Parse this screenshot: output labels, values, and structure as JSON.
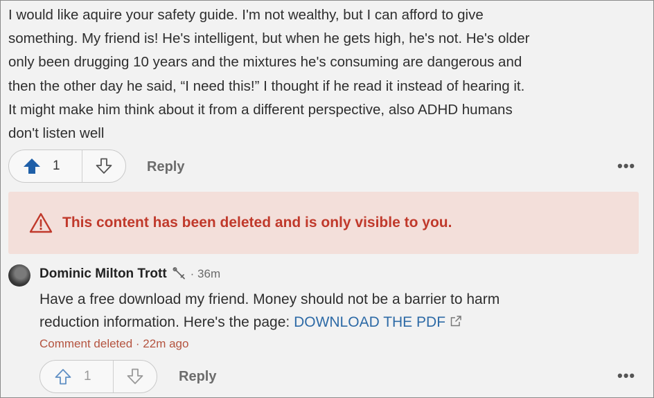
{
  "parent_comment": {
    "lines": [
      "I would like aquire your safety guide. I'm not wealthy, but I can afford to give",
      "something. My friend is! He's intelligent, but when he gets high, he's not. He's older",
      "only been drugging 10 years and the mixtures he's consuming are dangerous and",
      "then the other day he said, “I need this!” I thought if he read it instead of hearing it.",
      "It might make him think about it from a different perspective, also ADHD humans",
      "don't listen well"
    ],
    "upvote_count": "1",
    "reply_label": "Reply",
    "more_label": "•••",
    "upvote_color": "#1f5fa8"
  },
  "deleted_banner": {
    "message": "This content has been deleted and is only visible to you.",
    "accent_color": "#c0392b",
    "background": "#f3dfda",
    "icon": "warning-icon"
  },
  "reply_comment": {
    "author": "Dominic Milton Trott",
    "author_badge_icon": "wrench-icon",
    "time": "· 36m",
    "text_line1": "Have a free download my friend. Money should not be a barrier to harm",
    "text_line2_prefix": "reduction information. Here's the page: ",
    "link_text": "DOWNLOAD THE PDF",
    "link_icon": "external-link-icon",
    "deleted_note": "Comment deleted · 22m ago",
    "upvote_count": "1",
    "reply_label": "Reply",
    "more_label": "•••"
  }
}
